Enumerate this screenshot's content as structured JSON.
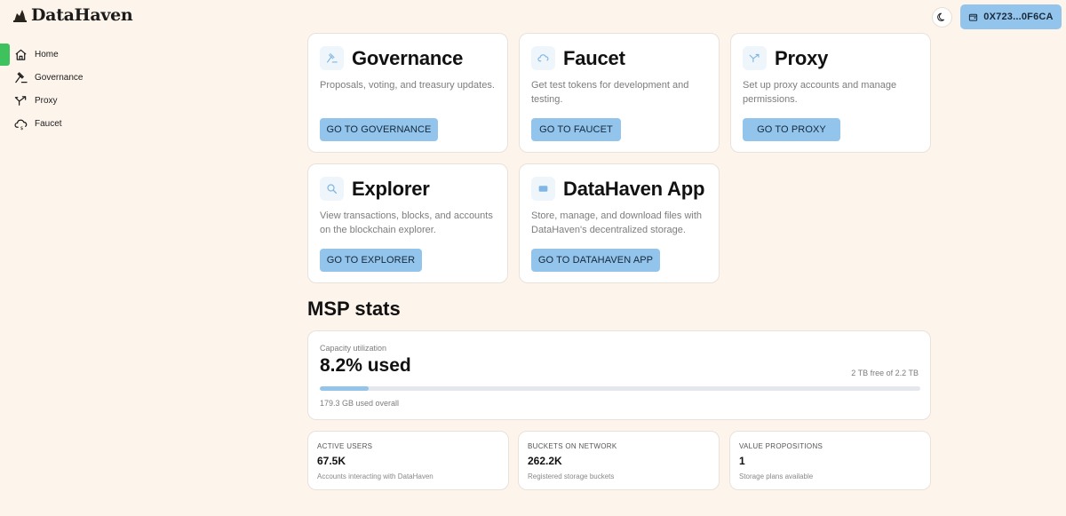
{
  "brand": {
    "name": "DataHaven"
  },
  "header": {
    "wallet_address": "0X723...0F6CA"
  },
  "sidebar": {
    "items": [
      {
        "label": "Home",
        "icon": "home-icon",
        "active": true
      },
      {
        "label": "Governance",
        "icon": "gavel-icon",
        "active": false
      },
      {
        "label": "Proxy",
        "icon": "split-arrow-icon",
        "active": false
      },
      {
        "label": "Faucet",
        "icon": "cloud-coin-icon",
        "active": false
      }
    ]
  },
  "apps": [
    {
      "title": "Governance",
      "description": "Proposals, voting, and treasury updates.",
      "button": "GO TO GOVERNANCE",
      "icon": "gavel-icon"
    },
    {
      "title": "Faucet",
      "description": "Get test tokens for development and testing.",
      "button": "GO TO FAUCET",
      "icon": "cloud-coin-icon"
    },
    {
      "title": "Proxy",
      "description": "Set up proxy accounts and manage permissions.",
      "button": "GO TO PROXY",
      "icon": "split-arrow-icon"
    },
    {
      "title": "Explorer",
      "description": "View transactions, blocks, and accounts on the blockchain explorer.",
      "button": "GO TO EXPLORER",
      "icon": "search-icon"
    },
    {
      "title": "DataHaven App",
      "description": "Store, manage, and download files with DataHaven's decentralized storage.",
      "button": "GO TO DATAHAVEN APP",
      "icon": "storage-icon"
    }
  ],
  "msp": {
    "title": "MSP stats",
    "capacity": {
      "label": "Capacity utilization",
      "used_text": "8.2% used",
      "used_fraction": 0.082,
      "free_text": "2 TB free of 2.2 TB",
      "overall_text": "179.3 GB used overall"
    },
    "stats": [
      {
        "label": "ACTIVE USERS",
        "value": "67.5K",
        "sub": "Accounts interacting with DataHaven"
      },
      {
        "label": "BUCKETS ON NETWORK",
        "value": "262.2K",
        "sub": "Registered storage buckets"
      },
      {
        "label": "VALUE PROPOSITIONS",
        "value": "1",
        "sub": "Storage plans available"
      }
    ]
  },
  "colors": {
    "background": "#fdf4ec",
    "accent_button": "#93c4ec",
    "active_indicator": "#3dc25e",
    "progress_fill": "#93c4ec",
    "progress_track": "#e4e8ec"
  }
}
